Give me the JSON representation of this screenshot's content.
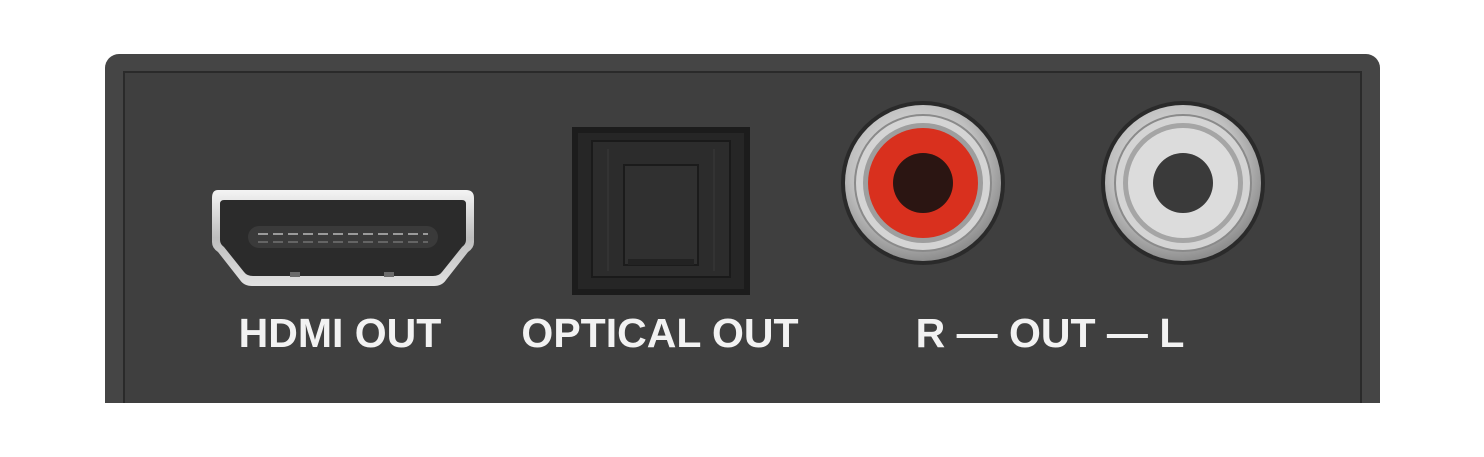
{
  "labels": {
    "hdmi": "HDMI OUT",
    "optical": "OPTICAL OUT",
    "audio": "R — OUT — L"
  },
  "colors": {
    "panel": "#454545",
    "inner": "#3f3f3f",
    "label": "#f2f2f2",
    "rca_right_insert": "#d9301e",
    "rca_left_insert": "#d8d8d8",
    "metal_ring": "#c8c8c8"
  },
  "icons": {
    "hdmi": "hdmi-port-icon",
    "optical": "optical-toslink-port-icon",
    "rca_right": "rca-jack-red-icon",
    "rca_left": "rca-jack-white-icon"
  }
}
